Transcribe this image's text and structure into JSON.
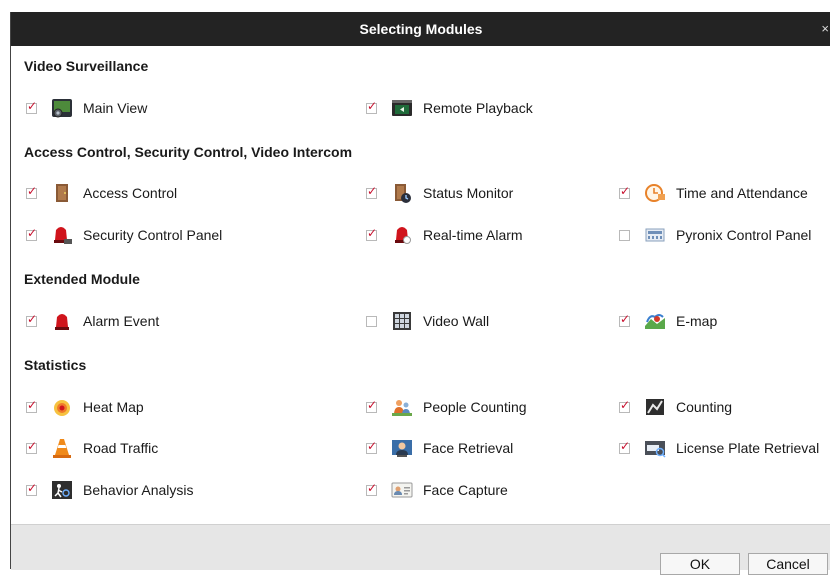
{
  "dialog": {
    "title": "Selecting Modules",
    "close_glyph": "×"
  },
  "sections": {
    "video_surveillance": "Video Surveillance",
    "access_control": "Access Control, Security Control, Video Intercom",
    "extended": "Extended Module",
    "statistics": "Statistics"
  },
  "modules": {
    "main_view": {
      "label": "Main View",
      "checked": true,
      "icon": "main-view-icon"
    },
    "remote_playback": {
      "label": "Remote Playback",
      "checked": true,
      "icon": "remote-playback-icon"
    },
    "access_control": {
      "label": "Access Control",
      "checked": true,
      "icon": "door-icon"
    },
    "status_monitor": {
      "label": "Status Monitor",
      "checked": true,
      "icon": "status-monitor-icon"
    },
    "time_attendance": {
      "label": "Time and Attendance",
      "checked": true,
      "icon": "clock-icon"
    },
    "security_panel": {
      "label": "Security Control Panel",
      "checked": true,
      "icon": "siren-icon"
    },
    "realtime_alarm": {
      "label": "Real-time Alarm",
      "checked": true,
      "icon": "realtime-alarm-icon"
    },
    "pyronix_panel": {
      "label": "Pyronix Control Panel",
      "checked": false,
      "icon": "control-panel-icon"
    },
    "alarm_event": {
      "label": "Alarm Event",
      "checked": true,
      "icon": "alarm-light-icon"
    },
    "video_wall": {
      "label": "Video Wall",
      "checked": false,
      "icon": "video-wall-icon"
    },
    "emap": {
      "label": "E-map",
      "checked": true,
      "icon": "map-icon"
    },
    "heat_map": {
      "label": "Heat Map",
      "checked": true,
      "icon": "heat-map-icon"
    },
    "people_counting": {
      "label": "People Counting",
      "checked": true,
      "icon": "people-counting-icon"
    },
    "counting": {
      "label": "Counting",
      "checked": true,
      "icon": "counting-icon"
    },
    "road_traffic": {
      "label": "Road Traffic",
      "checked": true,
      "icon": "traffic-cone-icon"
    },
    "face_retrieval": {
      "label": "Face Retrieval",
      "checked": true,
      "icon": "face-retrieval-icon"
    },
    "lpr": {
      "label": "License Plate Retrieval",
      "checked": true,
      "icon": "license-plate-icon"
    },
    "behavior": {
      "label": "Behavior Analysis",
      "checked": true,
      "icon": "behavior-analysis-icon"
    },
    "face_capture": {
      "label": "Face Capture",
      "checked": true,
      "icon": "face-capture-icon"
    }
  },
  "buttons": {
    "ok": "OK",
    "cancel": "Cancel"
  },
  "colors": {
    "titlebar": "#232323",
    "checkmark": "#c8102e",
    "footer": "#e6e6e6"
  }
}
